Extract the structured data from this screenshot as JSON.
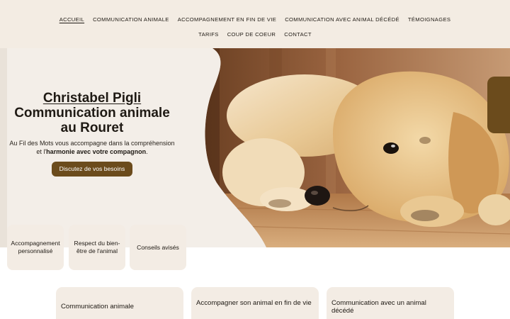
{
  "nav": {
    "row1": [
      "ACCUEIL",
      "COMMUNICATION ANIMALE",
      "ACCOMPAGNEMENT EN FIN DE VIE",
      "COMMUNICATION AVEC ANIMAL DÉCÉDÉ",
      "TÉMOIGNAGES"
    ],
    "row2": [
      "TARIFS",
      "COUP DE COEUR",
      "CONTACT"
    ]
  },
  "hero": {
    "title_line1": "Christabel Pigli",
    "title_line2": "Communication animale au Rouret",
    "desc_part1": "Au Fil des Mots vous accompagne dans la compréhension et l'",
    "desc_bold": "harmonie avec votre compagnon",
    "desc_part2": ".",
    "cta_label": "Discutez de vos besoins"
  },
  "features": [
    "Accompagnement personnalisé",
    "Respect du bien-être de l'animal",
    "Conseils avisés"
  ],
  "services": [
    "Communication animale",
    "Accompagner son animal en fin de vie",
    "Communication avec un animal décédé"
  ],
  "colors": {
    "accent": "#6b4b1c",
    "nav_bg": "#f3ece3",
    "card_bg": "#f3ece4"
  },
  "icons": {
    "hero_image": "puppy-photo",
    "side_tab": "side-tab-handle"
  }
}
